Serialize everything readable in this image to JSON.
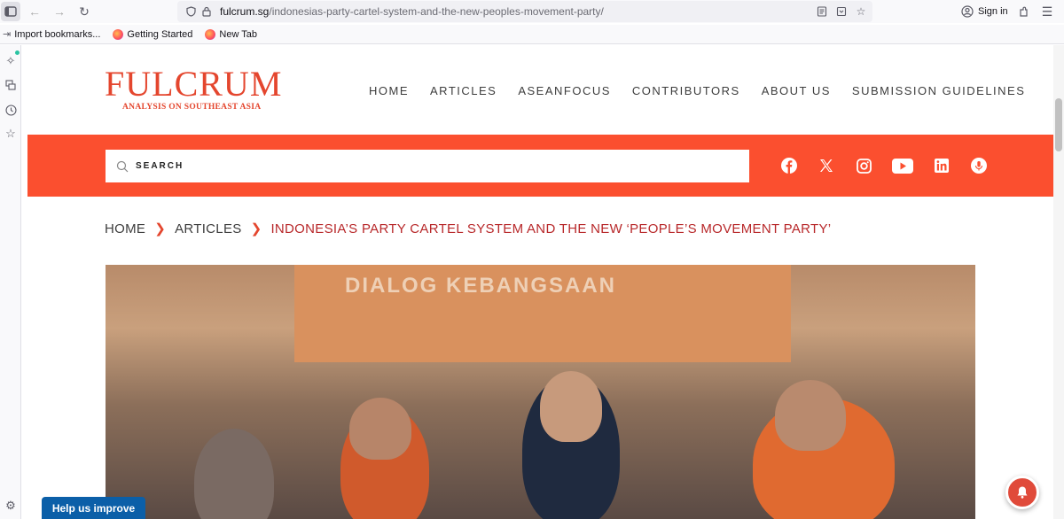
{
  "browser": {
    "url_host": "fulcrum.sg",
    "url_path": "/indonesias-party-cartel-system-and-the-new-peoples-movement-party/",
    "signin_label": "Sign in",
    "bookmarks": [
      "Import bookmarks...",
      "Getting Started",
      "New Tab"
    ]
  },
  "site": {
    "logo_title": "FULCRUM",
    "logo_subtitle": "ANALYSIS ON SOUTHEAST ASIA",
    "nav": [
      "HOME",
      "ARTICLES",
      "ASEANFOCUS",
      "CONTRIBUTORS",
      "ABOUT US",
      "SUBMISSION GUIDELINES"
    ],
    "search_placeholder": "SEARCH",
    "social": [
      "facebook-icon",
      "x-icon",
      "instagram-icon",
      "youtube-icon",
      "linkedin-icon",
      "podcast-icon"
    ],
    "accent_color": "#fb4f2f"
  },
  "breadcrumb": {
    "home": "HOME",
    "articles": "ARTICLES",
    "current": "INDONESIA’S PARTY CARTEL SYSTEM AND THE NEW ‘PEOPLE’S MOVEMENT PARTY’"
  },
  "hero": {
    "banner_text": "DIALOG KEBANGSAAN"
  },
  "widgets": {
    "help_label": "Help us improve"
  }
}
